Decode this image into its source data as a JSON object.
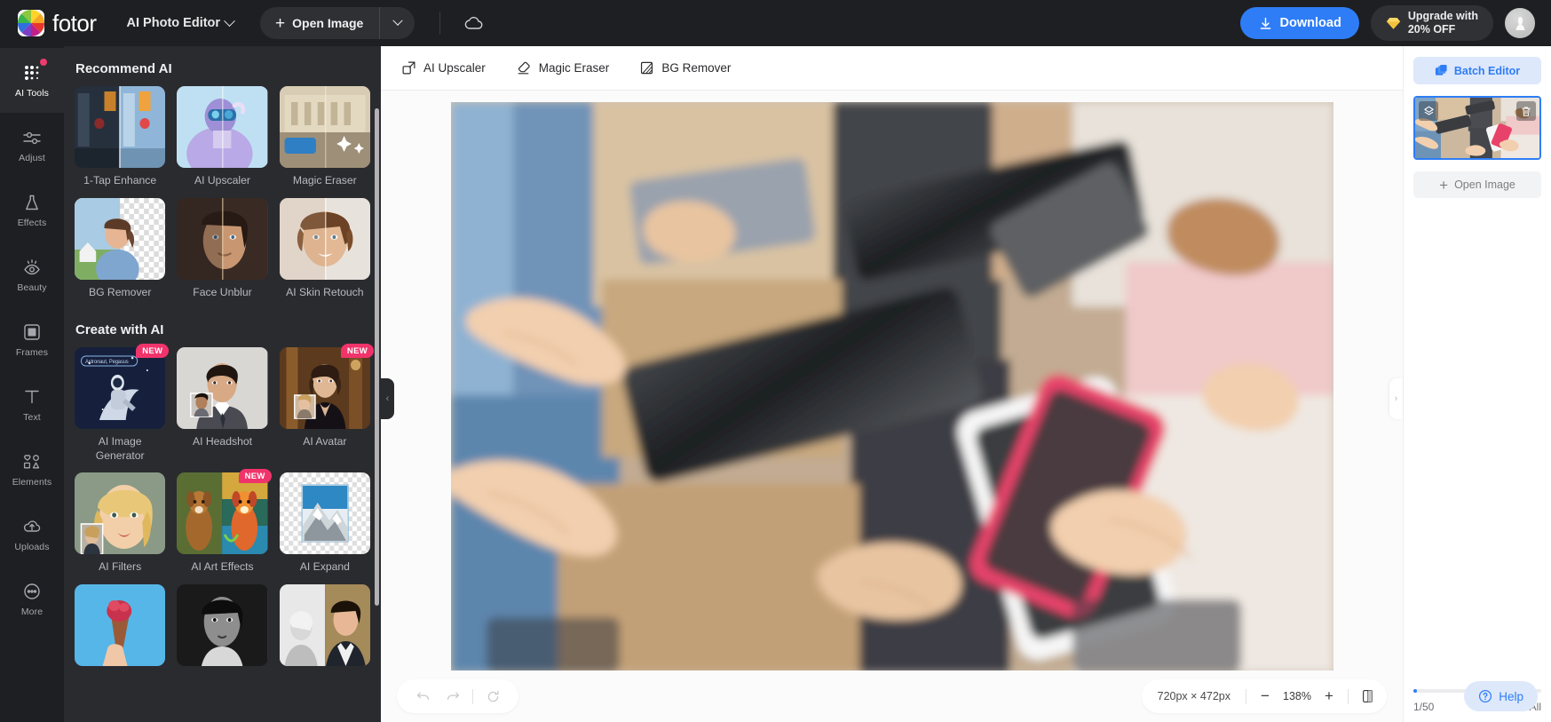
{
  "header": {
    "brand": "fotor",
    "app_switcher": "AI Photo Editor",
    "open_image": "Open Image",
    "download": "Download",
    "upgrade_line1": "Upgrade with",
    "upgrade_line2": "20% OFF",
    "icons": {
      "logo": "fotor-color-wheel-logo",
      "cloud": "cloud-icon",
      "plus": "+",
      "diamond": "diamond-icon",
      "avatar": "user-avatar"
    },
    "accent_blue": "#2e7df6",
    "bar_bg": "#1e1f22"
  },
  "rail": {
    "items": [
      {
        "label": "AI Tools",
        "icon": "grid-dots-icon",
        "active": true,
        "badge": true
      },
      {
        "label": "Adjust",
        "icon": "sliders-icon",
        "active": false,
        "badge": false
      },
      {
        "label": "Effects",
        "icon": "effects-icon",
        "active": false,
        "badge": false
      },
      {
        "label": "Beauty",
        "icon": "eye-icon",
        "active": false,
        "badge": false
      },
      {
        "label": "Frames",
        "icon": "frame-icon",
        "active": false,
        "badge": false
      },
      {
        "label": "Text",
        "icon": "text-t-icon",
        "active": false,
        "badge": false
      },
      {
        "label": "Elements",
        "icon": "shapes-icon",
        "active": false,
        "badge": false
      },
      {
        "label": "Uploads",
        "icon": "cloud-upload-icon",
        "active": false,
        "badge": false
      },
      {
        "label": "More",
        "icon": "ellipsis-icon",
        "active": false,
        "badge": false
      }
    ]
  },
  "panel": {
    "sections": [
      {
        "title": "Recommend AI",
        "cards": [
          {
            "label": "1-Tap Enhance",
            "badge": ""
          },
          {
            "label": "AI Upscaler",
            "badge": ""
          },
          {
            "label": "Magic Eraser",
            "badge": ""
          },
          {
            "label": "BG Remover",
            "badge": ""
          },
          {
            "label": "Face Unblur",
            "badge": ""
          },
          {
            "label": "AI Skin Retouch",
            "badge": ""
          }
        ]
      },
      {
        "title": "Create with AI",
        "cards": [
          {
            "label": "AI Image Generator",
            "badge": "NEW"
          },
          {
            "label": "AI Headshot",
            "badge": ""
          },
          {
            "label": "AI Avatar",
            "badge": "NEW"
          },
          {
            "label": "AI Filters",
            "badge": ""
          },
          {
            "label": "AI Art Effects",
            "badge": "NEW"
          },
          {
            "label": "AI Expand",
            "badge": ""
          }
        ]
      }
    ],
    "badge_color": "#f0346b"
  },
  "canvas_toolbar": {
    "items": [
      {
        "label": "AI Upscaler",
        "icon": "upscale-icon"
      },
      {
        "label": "Magic Eraser",
        "icon": "eraser-icon"
      },
      {
        "label": "BG Remover",
        "icon": "bg-remove-icon"
      }
    ]
  },
  "bottom_bar": {
    "undo": "undo-icon",
    "redo": "redo-icon",
    "reset": "reset-icon",
    "dimensions": "720px × 472px",
    "zoom_out": "−",
    "zoom_value": "138%",
    "zoom_in": "+",
    "compare": "compare-icon"
  },
  "right_panel": {
    "batch_editor": "Batch Editor",
    "open_image": "Open Image",
    "count": "1/50",
    "clear_all": "Clear All",
    "thumb_copy_icon": "layers-copy-icon",
    "thumb_delete_icon": "trash-icon"
  },
  "help": {
    "label": "Help",
    "icon": "question-circle-icon"
  },
  "collapse": {
    "left": "‹",
    "right": "›"
  }
}
